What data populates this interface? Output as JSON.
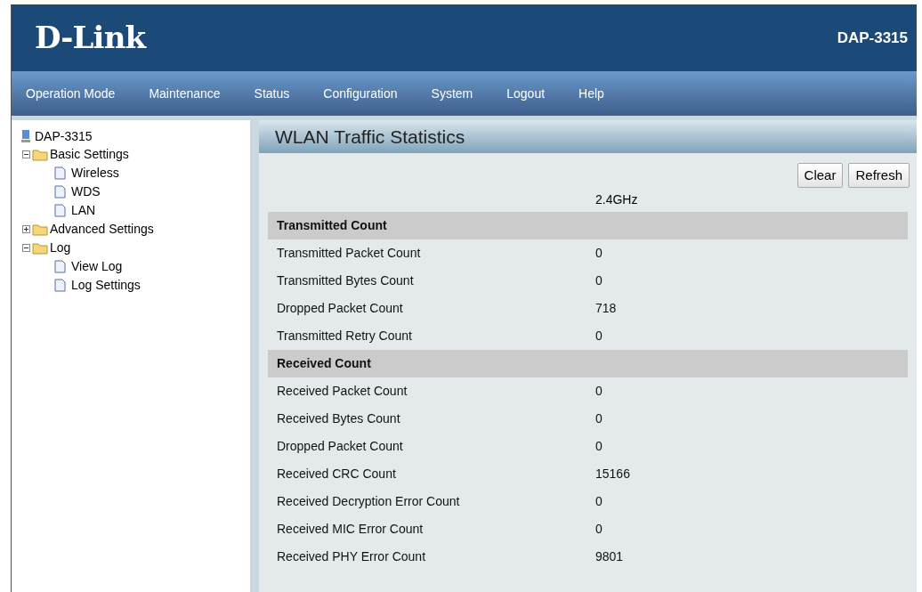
{
  "header": {
    "logo": "D-Link",
    "model": "DAP-3315"
  },
  "nav": [
    "Operation Mode",
    "Maintenance",
    "Status",
    "Configuration",
    "System",
    "Logout",
    "Help"
  ],
  "tree": {
    "label": "DAP-3315",
    "children": [
      {
        "label": "Basic Settings",
        "expanded": true,
        "children": [
          {
            "label": "Wireless"
          },
          {
            "label": "WDS"
          },
          {
            "label": "LAN"
          }
        ]
      },
      {
        "label": "Advanced Settings",
        "expanded": false
      },
      {
        "label": "Log",
        "expanded": true,
        "children": [
          {
            "label": "View Log"
          },
          {
            "label": "Log Settings"
          }
        ]
      }
    ]
  },
  "panel": {
    "title": "WLAN Traffic Statistics",
    "buttons": [
      "Clear",
      "Refresh"
    ],
    "band": "2.4GHz",
    "rows": [
      {
        "kind": "section",
        "label": "Transmitted Count"
      },
      {
        "kind": "row",
        "label": "Transmitted Packet Count",
        "value": "0"
      },
      {
        "kind": "row",
        "label": "Transmitted Bytes Count",
        "value": "0"
      },
      {
        "kind": "row",
        "label": "Dropped Packet Count",
        "value": "718"
      },
      {
        "kind": "row",
        "label": "Transmitted Retry Count",
        "value": "0"
      },
      {
        "kind": "section",
        "label": "Received Count"
      },
      {
        "kind": "row",
        "label": "Received Packet Count",
        "value": "0"
      },
      {
        "kind": "row",
        "label": "Received Bytes Count",
        "value": "0"
      },
      {
        "kind": "row",
        "label": "Dropped Packet Count",
        "value": "0"
      },
      {
        "kind": "row",
        "label": "Received CRC Count",
        "value": "15166"
      },
      {
        "kind": "row",
        "label": "Received Decryption Error Count",
        "value": "0"
      },
      {
        "kind": "row",
        "label": "Received MIC Error Count",
        "value": "0"
      },
      {
        "kind": "row",
        "label": "Received PHY Error Count",
        "value": "9801"
      }
    ]
  }
}
